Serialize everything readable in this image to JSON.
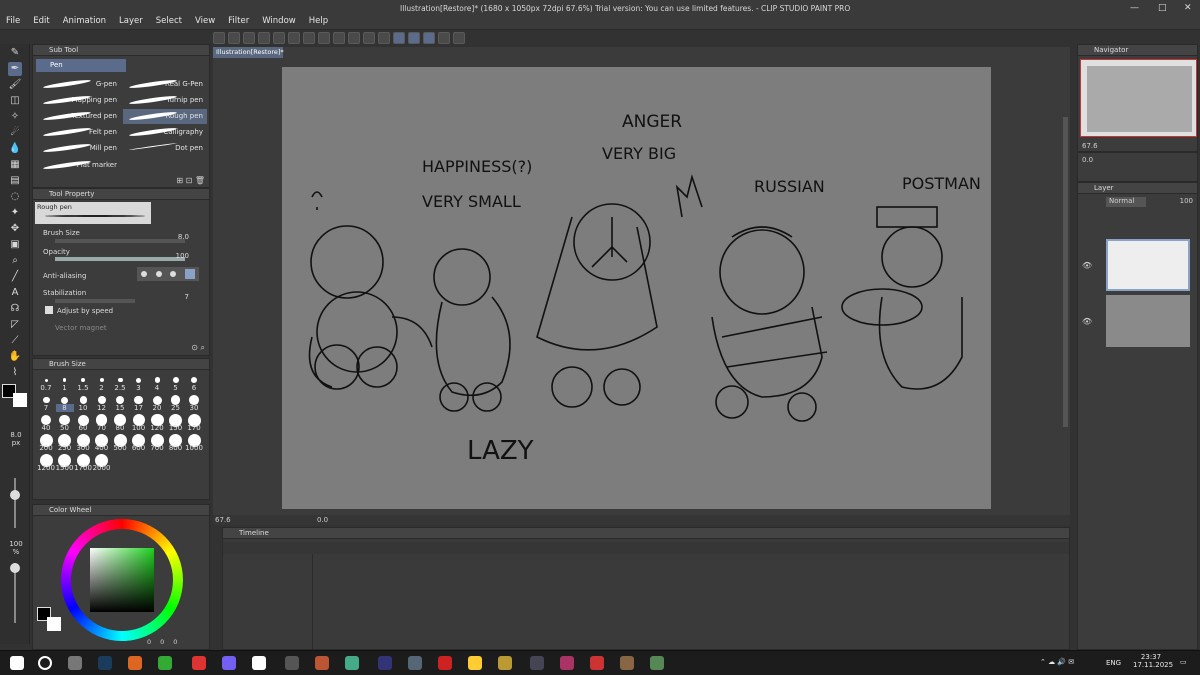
{
  "window": {
    "title": "Illustration[Restore]* (1680 x 1050px 72dpi 67.6%)  Trial version: You can use limited features. - CLIP STUDIO PAINT PRO",
    "menu": [
      "File",
      "Edit",
      "Animation",
      "Layer",
      "Select",
      "View",
      "Filter",
      "Window",
      "Help"
    ]
  },
  "subtool": {
    "header": "Sub Tool",
    "active_tab": "Pen",
    "brushes": [
      "G-pen",
      "Real G-Pen",
      "Mapping pen",
      "Turnip pen",
      "Textured pen",
      "Rough pen",
      "Felt pen",
      "Calligraphy",
      "Mill pen",
      "Dot pen",
      "Flat marker"
    ]
  },
  "tool_property": {
    "header": "Tool Property",
    "brush_name": "Rough pen",
    "brush_size_label": "Brush Size",
    "brush_size": "8.0",
    "opacity_label": "Opacity",
    "opacity": "100",
    "antialias_label": "Anti-aliasing",
    "stabilization_label": "Stabilization",
    "stabilization": "7",
    "adjust_speed_label": "Adjust by speed",
    "vector_magnet_label": "Vector magnet"
  },
  "brush_size_panel": {
    "header": "Brush Size",
    "sizes": [
      "0.7",
      "1",
      "1.5",
      "2",
      "2.5",
      "3",
      "4",
      "5",
      "6",
      "7",
      "8",
      "10",
      "12",
      "15",
      "17",
      "20",
      "25",
      "30",
      "40",
      "50",
      "60",
      "70",
      "80",
      "100",
      "120",
      "150",
      "170",
      "200",
      "250",
      "300",
      "400",
      "500",
      "600",
      "700",
      "800",
      "1000",
      "1200",
      "1500",
      "1700",
      "2000"
    ],
    "selected": "8"
  },
  "left_strip": {
    "size_value": "8.0",
    "size_unit": "px",
    "opacity_value": "100",
    "opacity_unit": "%"
  },
  "color_wheel": {
    "header": "Color Wheel",
    "values": [
      "0",
      "0",
      "0"
    ]
  },
  "document": {
    "tab": "Illustration[Restore]*"
  },
  "canvas_text": {
    "anger": "ANGER",
    "very_big": "VERY BIG",
    "happiness": "HAPPINESS(?)",
    "very_small": "VERY SMALL",
    "russian": "RUSSIAN",
    "postman": "POSTMAN",
    "lazy": "LAZY"
  },
  "status": {
    "zoom": "67.6",
    "angle": "0.0"
  },
  "timeline": {
    "header": "Timeline"
  },
  "navigator": {
    "header": "Navigator",
    "zoom": "67.6",
    "angle": "0.0"
  },
  "layer_property": {
    "header": "Layer",
    "blend": "Normal",
    "opacity": "100"
  },
  "taskbar": {
    "lang": "ENG",
    "time": "23:37",
    "date": "17.11.2025"
  },
  "colors": {
    "accent": "#5a6b8c",
    "canvas": "#7d7d7d",
    "panel": "#3c3c3c"
  }
}
